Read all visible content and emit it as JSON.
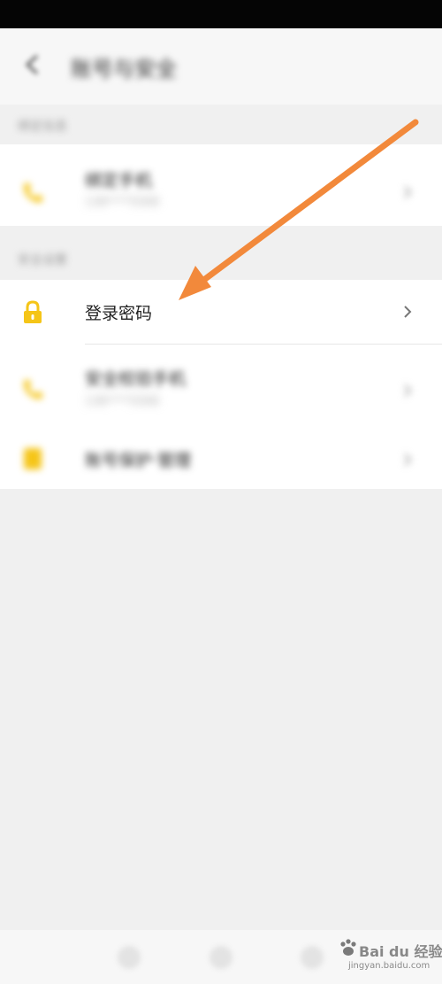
{
  "header": {
    "title": "账号与安全"
  },
  "sections": {
    "first_label": "绑定信息",
    "second_label": "安全设置"
  },
  "rows": {
    "bind_phone": {
      "title": "绑定手机",
      "subtitle": "138****5568"
    },
    "login_password": {
      "title": "登录密码"
    },
    "safety_phone": {
      "title": "安全校验手机",
      "subtitle": "138****5568"
    },
    "account_device": {
      "title": "账号保护·管理"
    }
  },
  "watermark": {
    "text": "Bai du 经验",
    "domain": "jingyan.baidu.com"
  },
  "icons": {
    "back": "back-arrow-icon",
    "phone": "phone-icon",
    "lock": "lock-icon",
    "badge": "badge-icon",
    "chevron": "chevron-right-icon"
  },
  "colors": {
    "accent_yellow": "#f5c518",
    "annotation_orange": "#f2893b"
  }
}
